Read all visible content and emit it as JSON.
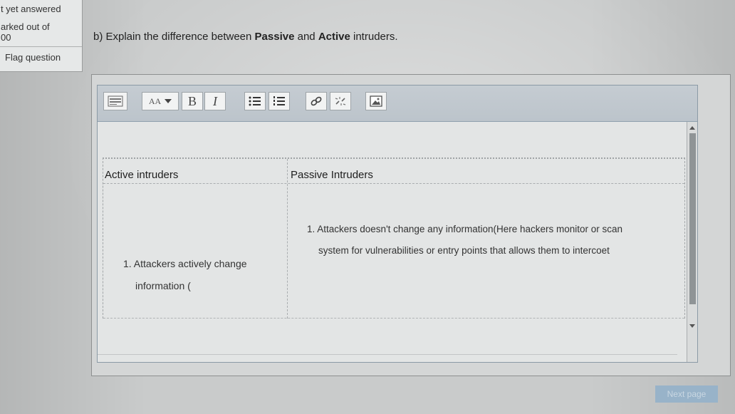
{
  "side_panel": {
    "status": "t yet answered",
    "marked_line": "arked out of",
    "marks": "00",
    "flag_label": "Flag question"
  },
  "question": {
    "prefix": "b) Explain the difference between ",
    "term1": "Passive",
    "middle": " and ",
    "term2": "Active",
    "suffix": " intruders."
  },
  "toolbar": {
    "buttons": [
      "toggle-toolbar-icon",
      "font-size-icon",
      "bold-icon",
      "italic-icon",
      "unordered-list-icon",
      "ordered-list-icon",
      "link-icon",
      "unlink-icon",
      "image-icon"
    ],
    "font_label": "AA",
    "bold_label": "B",
    "italic_label": "I"
  },
  "answer_table": {
    "headers": [
      "Active intruders",
      "Passive Intruders"
    ],
    "active_lines": [
      "1. Attackers actively change",
      "information ("
    ],
    "passive_lines": [
      "1. Attackers doesn't change any information(Here hackers monitor or scan",
      "system for vulnerabilities or entry points that allows them to intercoet"
    ]
  },
  "next_button": "Next page"
}
